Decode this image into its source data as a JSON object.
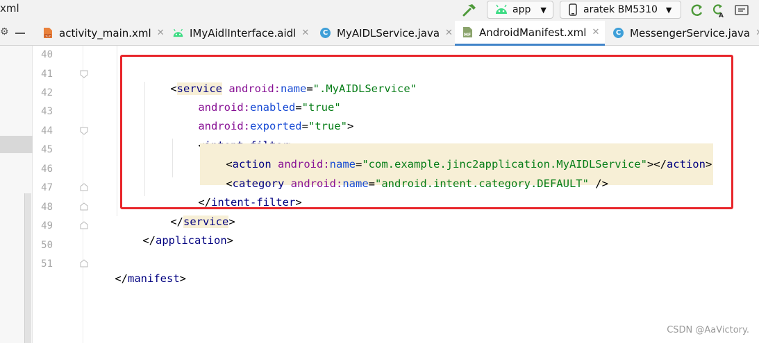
{
  "toolbar": {
    "project_tail": "xml",
    "config_label": "app",
    "device_label": "aratek BM5310"
  },
  "tabs": [
    {
      "label": "activity_main.xml",
      "icon": "layout-xml-icon",
      "active": false
    },
    {
      "label": "IMyAidlInterface.aidl",
      "icon": "android-icon",
      "active": false
    },
    {
      "label": "MyAIDLService.java",
      "icon": "class-c-icon",
      "active": false
    },
    {
      "label": "AndroidManifest.xml",
      "icon": "manifest-mf-icon",
      "active": true
    },
    {
      "label": "MessengerService.java",
      "icon": "class-c-icon",
      "active": false
    }
  ],
  "editor": {
    "line_numbers": [
      "40",
      "41",
      "42",
      "43",
      "44",
      "45",
      "46",
      "47",
      "48",
      "49",
      "50",
      "51"
    ],
    "lines": {
      "l41": {
        "open": "<",
        "tag": "service",
        "ns": "android:",
        "attr": "name",
        "eq": "=",
        "val": "\".MyAIDLService\""
      },
      "l42": {
        "ns": "android:",
        "attr": "enabled",
        "eq": "=",
        "val": "\"true\""
      },
      "l43": {
        "ns": "android:",
        "attr": "exported",
        "eq": "=",
        "val": "\"true\"",
        "close": ">"
      },
      "l44": {
        "open": "<",
        "tag": "intent-filter",
        "close": ">"
      },
      "l45": {
        "open": "<",
        "tag": "action",
        "ns": "android:",
        "attr": "name",
        "eq": "=",
        "val": "\"com.example.jinc2application.MyAIDLService\"",
        "mid": "></",
        "tag2": "action",
        "close": ">"
      },
      "l46": {
        "open": "<",
        "tag": "category",
        "ns": "android:",
        "attr": "name",
        "eq": "=",
        "val": "\"android.intent.category.DEFAULT\"",
        "close": " />"
      },
      "l47": {
        "open": "</",
        "tag": "intent-filter",
        "close": ">"
      },
      "l48": {
        "open": "</",
        "tag": "service",
        "close": ">"
      },
      "l49": {
        "open": "</",
        "tag": "application",
        "close": ">"
      },
      "l51": {
        "open": "</",
        "tag": "manifest",
        "close": ">"
      }
    }
  },
  "watermark": "CSDN @AaVictory.",
  "colors": {
    "tag": "#000080",
    "namespace": "#871094",
    "attribute": "#174ad4",
    "string": "#067d17",
    "highlight": "#f7efd6",
    "annotation_box": "#e8262b",
    "active_tab_underline": "#4083c9"
  }
}
